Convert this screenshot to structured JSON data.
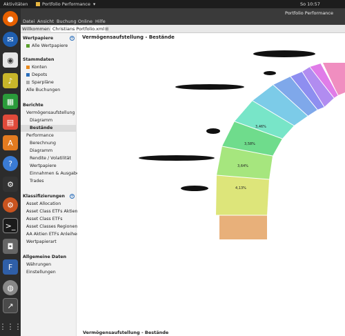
{
  "topbar": {
    "activities": "Aktivitäten",
    "app_menu": "Portfolio Performance",
    "clock": "So 10:57"
  },
  "window": {
    "title": "Portfolio Performance"
  },
  "menu": {
    "items": [
      "Datei",
      "Ansicht",
      "Buchung",
      "Online",
      "Hilfe"
    ]
  },
  "tabs": [
    {
      "label": "Willkommen"
    },
    {
      "label": "Christians Portfolio.xml"
    }
  ],
  "sidebar": {
    "wertpapiere": {
      "title": "Wertpapiere",
      "items": [
        "Alle Wertpapiere"
      ]
    },
    "stammdaten": {
      "title": "Stammdaten",
      "items": [
        "Konten",
        "Depots",
        "Sparpläne",
        "Alle Buchungen"
      ]
    },
    "berichte": {
      "title": "Berichte",
      "items": [
        "Vermögensaufstellung",
        "Diagramm",
        "Bestände",
        "Performance",
        "Berechnung",
        "Diagramm",
        "Rendite / Volatilität",
        "Wertpapiere",
        "Einnahmen & Ausgaben",
        "Trades"
      ]
    },
    "klassifizierungen": {
      "title": "Klassifizierungen",
      "items": [
        "Asset Allocation",
        "Asset Class ETFs Aktien",
        "Asset Class ETFs",
        "Asset Classes Regionen",
        "AA Aktien ETFs Anleihen",
        "Wertpapierart"
      ]
    },
    "allgemeine": {
      "title": "Allgemeine Daten",
      "items": [
        "Währungen",
        "Einstellungen"
      ]
    }
  },
  "main": {
    "title": "Vermögensaufstellung - Bestände",
    "bottom_title": "Vermögensaufstellung - Bestände",
    "donut_labels": [
      "3,46%",
      "3,58%",
      "3,64%",
      "4,13%"
    ]
  },
  "colors": {
    "accent": "#2a6ebb",
    "konten": "#e8891e",
    "depots": "#2a6ebb",
    "sparplaene": "#aaaaaa",
    "selected": "#dcdcdc"
  }
}
